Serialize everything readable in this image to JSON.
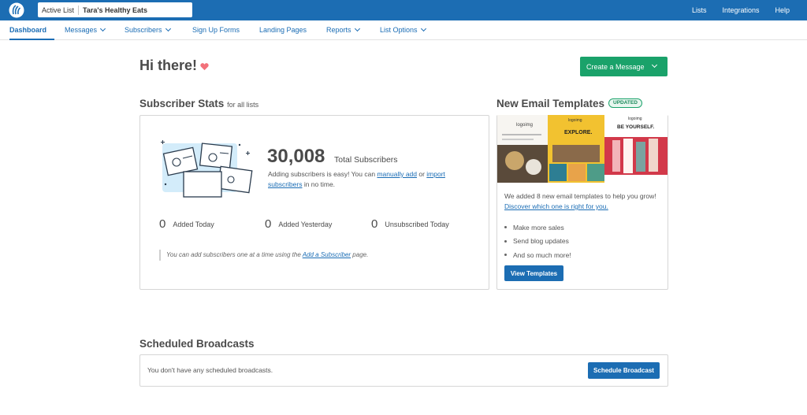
{
  "topbar": {
    "active_list_label": "Active List",
    "active_list_value": "Tara's Healthy Eats",
    "nav": [
      "Lists",
      "Integrations",
      "Help"
    ]
  },
  "subnav": {
    "items": [
      {
        "label": "Dashboard",
        "active": true,
        "dropdown": false
      },
      {
        "label": "Messages",
        "dropdown": true
      },
      {
        "label": "Subscribers",
        "dropdown": true
      },
      {
        "label": "Sign Up Forms",
        "dropdown": false
      },
      {
        "label": "Landing Pages",
        "dropdown": false
      },
      {
        "label": "Reports",
        "dropdown": true
      },
      {
        "label": "List Options",
        "dropdown": true
      }
    ]
  },
  "greeting": "Hi there!",
  "create_button": "Create a Message",
  "stats": {
    "title": "Subscriber Stats",
    "title_suffix": "for all lists",
    "total": "30,008",
    "total_label": "Total Subscribers",
    "adding_pre": "Adding subscribers is easy! You can ",
    "manually_add": "manually add",
    "or": " or ",
    "import": "import subscribers",
    "adding_post": " in no time.",
    "added_today_value": "0",
    "added_today_label": "Added Today",
    "added_yesterday_value": "0",
    "added_yesterday_label": "Added Yesterday",
    "unsub_today_value": "0",
    "unsub_today_label": "Unsubscribed Today",
    "tip_pre": "You can add subscribers one at a time using the ",
    "tip_link": "Add a Subscriber",
    "tip_post": " page."
  },
  "templates": {
    "title": "New Email Templates",
    "badge": "UPDATED",
    "preview_logo": "logoimg",
    "preview_explore": "EXPLORE.",
    "preview_be_yourself": "BE YOURSELF.",
    "text_pre": "We added 8 new email templates to help you grow! ",
    "text_link": "Discover which one is right for you.",
    "bullets": [
      "Make more sales",
      "Send blog updates",
      "And so much more!"
    ],
    "button": "View Templates"
  },
  "broadcasts": {
    "title": "Scheduled Broadcasts",
    "empty_message": "You don't have any scheduled broadcasts.",
    "button": "Schedule Broadcast"
  },
  "colors": {
    "brand_blue": "#1c6db3",
    "link_blue": "#1b6db5",
    "create_green": "#1aa26a",
    "heart_pink": "#f2717a"
  }
}
